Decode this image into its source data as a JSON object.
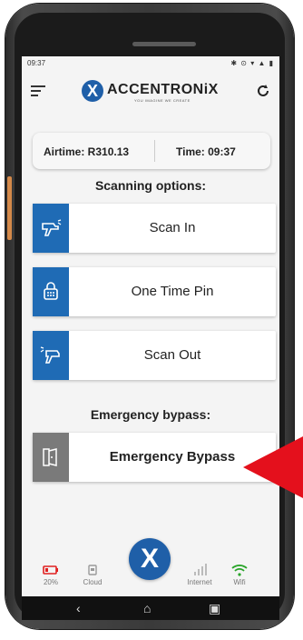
{
  "status_bar": {
    "time": "09:37",
    "icons": "✱ ⊙ ▾ ▲ ▮"
  },
  "app": {
    "brand": "ACCENTRONiX",
    "brand_mark": "X",
    "tagline": "YOU IMAGINE WE CREATE",
    "menu_icon": "menu-icon",
    "refresh_icon": "refresh-icon"
  },
  "info": {
    "airtime": "Airtime: R310.13",
    "time": "Time: 09:37"
  },
  "scanning": {
    "title": "Scanning options:",
    "options": [
      {
        "label": "Scan In",
        "icon": "scanner-in-icon"
      },
      {
        "label": "One Time Pin",
        "icon": "keypad-lock-icon"
      },
      {
        "label": "Scan Out",
        "icon": "scanner-out-icon"
      }
    ]
  },
  "emergency": {
    "title": "Emergency bypass:",
    "button_label": "Emergency Bypass",
    "icon": "door-open-icon"
  },
  "bottom_nav": {
    "battery": "20%",
    "cloud": "Cloud",
    "internet": "Internet",
    "wifi": "Wifi",
    "fab": "X"
  },
  "system_nav": {
    "back": "‹",
    "home": "⌂",
    "recents": "▣"
  },
  "colors": {
    "brand": "#1f5fa8",
    "option_icon_bg": "#1f6bb5",
    "bypass_icon_bg": "#7a7a7a",
    "pointer": "#e4101c",
    "battery": "#e02020",
    "wifi": "#2aa52a"
  }
}
